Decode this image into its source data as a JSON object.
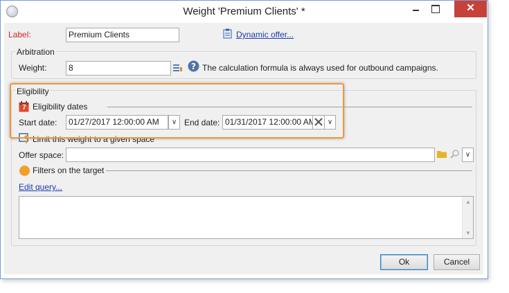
{
  "window": {
    "title": "Weight 'Premium Clients' *",
    "close_glyph": "✕"
  },
  "form": {
    "label_caption": "Label:",
    "label_value": "Premium Clients",
    "dynamic_offer_link": "Dynamic offer..."
  },
  "arbitration": {
    "title": "Arbitration",
    "weight_caption": "Weight:",
    "weight_value": "8",
    "help_text": "The calculation formula is always used for outbound campaigns."
  },
  "eligibility": {
    "title": "Eligibility",
    "dates_section": "Eligibility dates",
    "start_caption": "Start date:",
    "start_value": "01/27/2017 12:00:00 AM",
    "end_caption": "End date:",
    "end_value": "01/31/2017 12:00:00 AM",
    "calendar_day": "7",
    "limit_section": "Limit this weight to a given space",
    "offer_space_caption": "Offer space:",
    "offer_space_value": "",
    "filters_section": "Filters on the target",
    "edit_query_link": "Edit query...",
    "query_text": ""
  },
  "buttons": {
    "ok_label": "Ok",
    "cancel_label": "Cancel"
  },
  "colors": {
    "highlight": "#f3953f",
    "label_red": "#d22323",
    "close_red": "#c7413b",
    "link_blue": "#1a3ea8",
    "filter_orange": "#f0a02a"
  }
}
